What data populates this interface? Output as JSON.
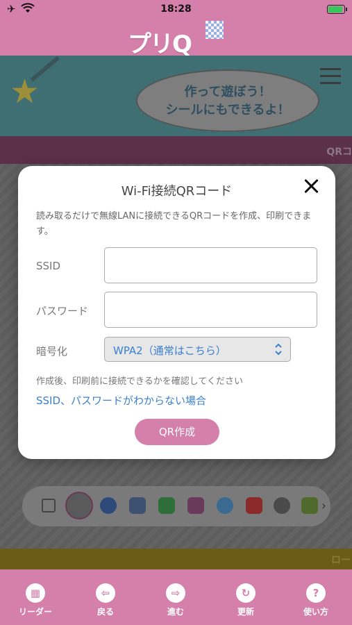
{
  "status_bar": {
    "time": "18:28"
  },
  "header": {
    "logo_text": "プリQ"
  },
  "background": {
    "banner_text_line1": "作って遊ぼう！",
    "banner_text_line2": "シールにもできるよ！",
    "band_text": "QRコ",
    "yellow_band_text": "ロー"
  },
  "modal": {
    "title": "Wi-Fi接続QRコード",
    "description": "読み取るだけで無線LANに接続できるQRコードを作成、印刷できます。",
    "ssid_label": "SSID",
    "ssid_value": "",
    "password_label": "パスワード",
    "password_value": "",
    "encryption_label": "暗号化",
    "encryption_value": "WPA2（通常はこちら）",
    "note": "作成後、印刷前に接続できるかを確認してください",
    "help_link": "SSID、パスワードがわからない場合",
    "create_button": "QR作成"
  },
  "tabbar": {
    "items": [
      {
        "label": "リーダー",
        "icon": "qr-icon",
        "glyph": "▦"
      },
      {
        "label": "戻る",
        "icon": "back-arrow-icon",
        "glyph": "⇦"
      },
      {
        "label": "進む",
        "icon": "forward-arrow-icon",
        "glyph": "⇨"
      },
      {
        "label": "更新",
        "icon": "refresh-icon",
        "glyph": "↻"
      },
      {
        "label": "使い方",
        "icon": "help-icon",
        "glyph": "?"
      }
    ]
  },
  "colors": {
    "accent": "#d580ab",
    "link": "#3a7fd0"
  }
}
